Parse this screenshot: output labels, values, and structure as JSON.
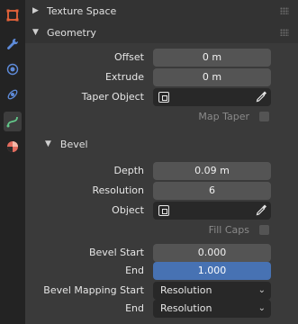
{
  "tabs": [
    {
      "icon": "object-icon",
      "color": "#e5633a"
    },
    {
      "icon": "wrench-icon",
      "color": "#5e8bd9"
    },
    {
      "icon": "particles-icon",
      "color": "#5e8bd9"
    },
    {
      "icon": "physics-icon",
      "color": "#5e8bd9"
    },
    {
      "icon": "curve-data-icon",
      "color": "#63c88a"
    },
    {
      "icon": "material-icon",
      "color": "#e36c5e"
    }
  ],
  "texture_space": {
    "label": "Texture Space",
    "expanded": false
  },
  "geometry": {
    "label": "Geometry",
    "offset": {
      "label": "Offset",
      "value": "0 m"
    },
    "extrude": {
      "label": "Extrude",
      "value": "0 m"
    },
    "taper_object": {
      "label": "Taper Object"
    },
    "map_taper": {
      "label": "Map Taper",
      "checked": false
    }
  },
  "bevel": {
    "label": "Bevel",
    "depth": {
      "label": "Depth",
      "value": "0.09 m"
    },
    "resolution": {
      "label": "Resolution",
      "value": "6"
    },
    "object": {
      "label": "Object"
    },
    "fill_caps": {
      "label": "Fill Caps",
      "checked": false
    },
    "bevel_start": {
      "label": "Bevel Start",
      "value": "0.000"
    },
    "end": {
      "label": "End",
      "value": "1.000"
    },
    "mapping_start": {
      "label": "Bevel Mapping Start",
      "value": "Resolution"
    },
    "mapping_end": {
      "label": "End",
      "value": "Resolution"
    }
  },
  "colors": {
    "accent": "#4772b3"
  }
}
